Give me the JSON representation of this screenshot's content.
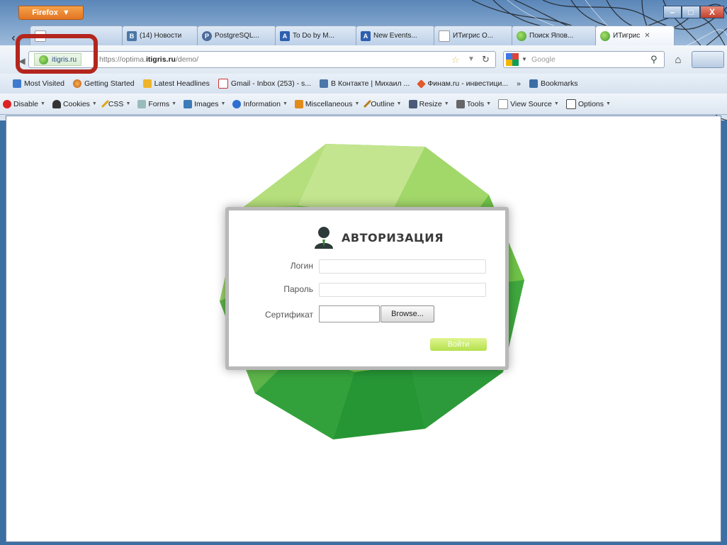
{
  "browser": {
    "app_button": "Firefox",
    "window_controls": {
      "minimize": "–",
      "maximize": "□",
      "close": "X"
    }
  },
  "tabs": [
    {
      "label": "",
      "icon": "blank-icon"
    },
    {
      "label": "(14) Новости",
      "icon": "vk-icon"
    },
    {
      "label": "PostgreSQL...",
      "icon": "postgresql-icon"
    },
    {
      "label": "To Do by M...",
      "icon": "a-icon"
    },
    {
      "label": "New Events...",
      "icon": "a-icon"
    },
    {
      "label": "ИТигрис О...",
      "icon": "blank-icon"
    },
    {
      "label": "Поиск Япов...",
      "icon": "globe-icon"
    },
    {
      "label": "ИТигрис",
      "icon": "globe-icon",
      "active": true
    }
  ],
  "navbar": {
    "identity": "itigris.ru",
    "url_prefix": "https://optima.",
    "url_domain": "itigris.ru",
    "url_path": "/demo/",
    "search_placeholder": "Google"
  },
  "bookmarks": [
    {
      "label": "Most Visited",
      "icon": "firefox-icon"
    },
    {
      "label": "Getting Started",
      "icon": "firefox-icon"
    },
    {
      "label": "Latest Headlines",
      "icon": "rss-icon"
    },
    {
      "label": "Gmail - Inbox (253) - s...",
      "icon": "gmail-icon"
    },
    {
      "label": "В Контакте | Михаил ...",
      "icon": "vk-icon"
    },
    {
      "label": "Финам.ru - инвестици...",
      "icon": "finam-icon"
    },
    {
      "label": "»",
      "icon": ""
    },
    {
      "label": "Bookmarks",
      "icon": "bookmarks-icon"
    }
  ],
  "devbar": [
    {
      "label": "Disable",
      "icon": "disable-icon"
    },
    {
      "label": "Cookies",
      "icon": "cookies-icon"
    },
    {
      "label": "CSS",
      "icon": "css-icon"
    },
    {
      "label": "Forms",
      "icon": "forms-icon"
    },
    {
      "label": "Images",
      "icon": "images-icon"
    },
    {
      "label": "Information",
      "icon": "information-icon"
    },
    {
      "label": "Miscellaneous",
      "icon": "miscellaneous-icon"
    },
    {
      "label": "Outline",
      "icon": "outline-icon"
    },
    {
      "label": "Resize",
      "icon": "resize-icon"
    },
    {
      "label": "Tools",
      "icon": "tools-icon"
    },
    {
      "label": "View Source",
      "icon": "view-source-icon"
    },
    {
      "label": "Options",
      "icon": "options-icon"
    }
  ],
  "login": {
    "title": "АВТОРИЗАЦИЯ",
    "login_label": "Логин",
    "password_label": "Пароль",
    "certificate_label": "Сертификат",
    "browse_button": "Browse...",
    "submit_button": "Войти"
  },
  "colors": {
    "annotation_highlight": "#b3261e",
    "gem_light": "#b7e07a",
    "gem_dark": "#2c9a3a",
    "submit_button": "#b4e04e"
  }
}
